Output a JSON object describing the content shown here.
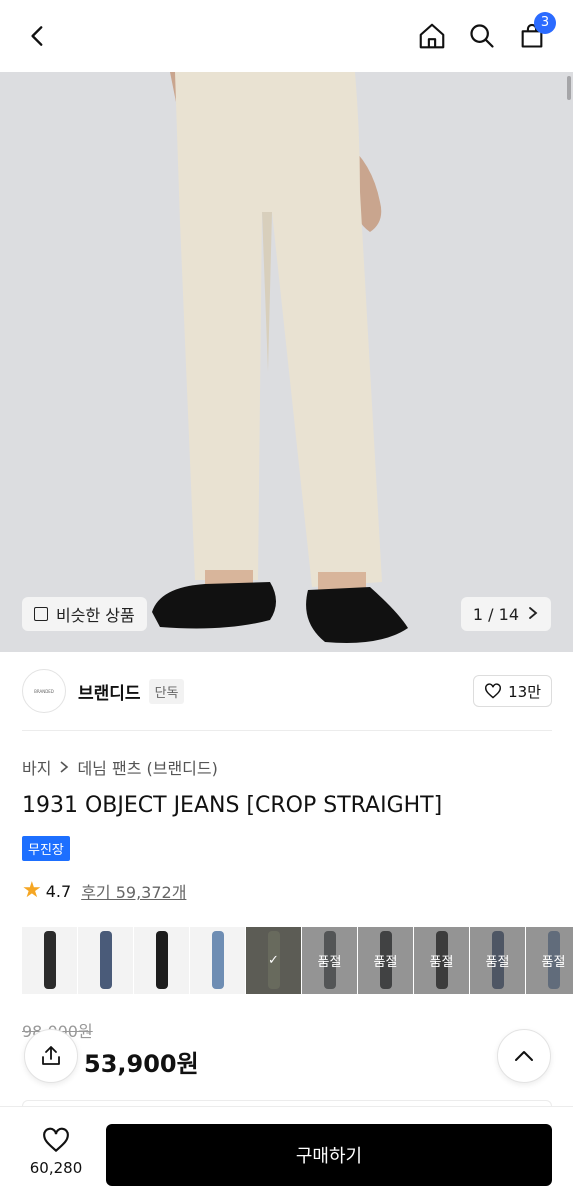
{
  "header": {
    "cart_count": "3"
  },
  "gallery": {
    "similar_label": "비슷한 상품",
    "counter": "1 / 14"
  },
  "brand": {
    "logo_text": "BRANDED",
    "name": "브랜디드",
    "exclusive": "단독",
    "likes": "13만"
  },
  "breadcrumb": {
    "category": "바지",
    "subcategory": "데님 팬츠 (브랜디드)"
  },
  "product": {
    "title": "1931 OBJECT JEANS [CROP STRAIGHT]",
    "tag": "무진장"
  },
  "rating": {
    "score": "4.7",
    "reviews": "후기 59,372개"
  },
  "options": {
    "sold_out": "품절",
    "items": [
      {
        "color": "#2b2b2b"
      },
      {
        "color": "#4a5b79"
      },
      {
        "color": "#1d1d1d"
      },
      {
        "color": "#6e8db3"
      },
      {
        "color": "#8b8f70"
      },
      {
        "color": "#5a5d60"
      },
      {
        "color": "#2f3033"
      },
      {
        "color": "#222222"
      },
      {
        "color": "#4e6182"
      },
      {
        "color": "#7a94b8"
      }
    ]
  },
  "pricing": {
    "original": "98,000원",
    "sale": "53,900원"
  },
  "bottom": {
    "wish_count": "60,280",
    "buy_label": "구매하기"
  },
  "colors": {
    "accent": "#2b6bff",
    "tag": "#1d6fff",
    "star": "#f5a623"
  }
}
